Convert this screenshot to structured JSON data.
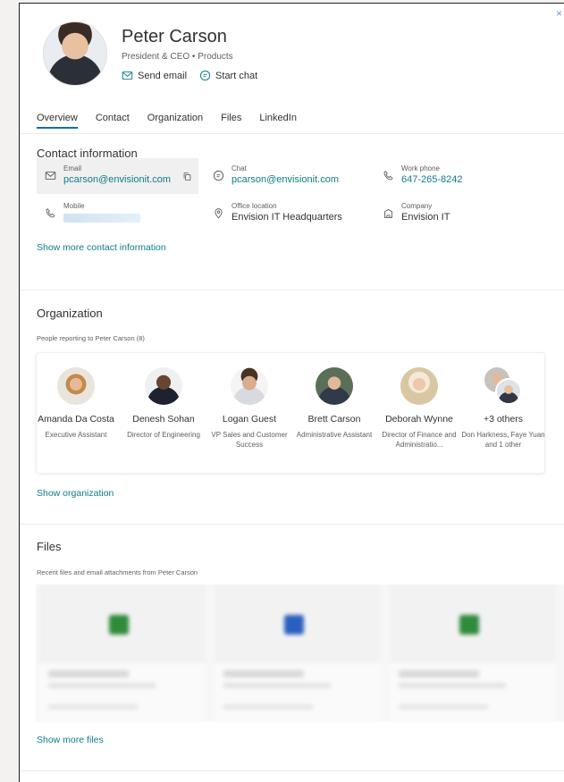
{
  "header": {
    "name": "Peter Carson",
    "role": "President & CEO • Products",
    "send_email": "Send email",
    "start_chat": "Start chat",
    "close_glyph": "×"
  },
  "tabs": [
    "Overview",
    "Contact",
    "Organization",
    "Files",
    "LinkedIn"
  ],
  "contact": {
    "title": "Contact information",
    "email": {
      "label": "Email",
      "value": "pcarson@envisionit.com",
      "icon": "mail-icon"
    },
    "chat": {
      "label": "Chat",
      "value": "pcarson@envisionit.com",
      "icon": "chat-icon"
    },
    "work_phone": {
      "label": "Work phone",
      "value": "647-265-8242",
      "icon": "phone-icon"
    },
    "mobile": {
      "label": "Mobile",
      "icon": "phone-icon"
    },
    "office": {
      "label": "Office location",
      "value": "Envision IT Headquarters",
      "icon": "location-icon"
    },
    "company": {
      "label": "Company",
      "value": "Envision IT",
      "icon": "building-icon"
    },
    "show_more": "Show more contact information"
  },
  "organization": {
    "title": "Organization",
    "subtitle": "People reporting to Peter Carson (8)",
    "people": [
      {
        "name": "Amanda Da Costa",
        "title": "Executive Assistant"
      },
      {
        "name": "Denesh Sohan",
        "title": "Director of Engineering"
      },
      {
        "name": "Logan Guest",
        "title": "VP Sales and Customer Success"
      },
      {
        "name": "Brett Carson",
        "title": "Administrative Assistant"
      },
      {
        "name": "Deborah Wynne",
        "title": "Director of Finance and Administratio..."
      },
      {
        "name": "+3 others",
        "title": "Don Harkness, Faye Yuan and 1 other"
      }
    ],
    "show_link": "Show organization"
  },
  "files": {
    "title": "Files",
    "subtitle": "Recent files and email attachments from Peter Carson",
    "show_more": "Show more files",
    "file_icon_colors": [
      "#2e8b3a",
      "#2b5fbf",
      "#2e8b3a"
    ]
  },
  "colors": {
    "accent": "#0f7c8c",
    "tab_underline": "#0f6cbd"
  }
}
